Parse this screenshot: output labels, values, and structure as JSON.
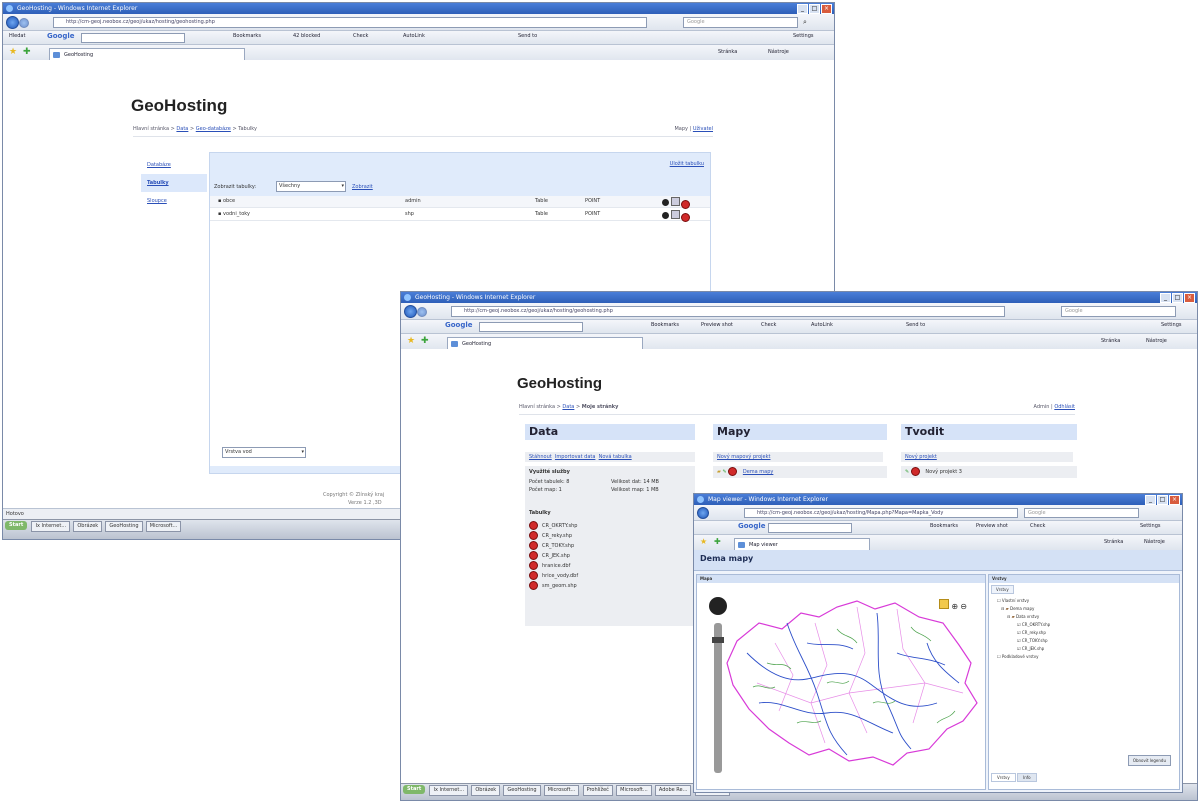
{
  "window1": {
    "title": "GeoHosting - Windows Internet Explorer",
    "address": "http://cm-geoj.neobox.cz/geoj/ukaz/hosting/geohosting.php",
    "search_placeholder": "Google",
    "toolbar": {
      "label": "Hledat",
      "google": "Google",
      "bookmarks": "Bookmarks",
      "blocked": "42 blocked",
      "check": "Check",
      "autolink": "AutoLink",
      "send": "Send to",
      "settings": "Settings"
    },
    "tab": "GeoHosting",
    "cmd": {
      "page": "Stránka",
      "tools": "Nástroje"
    },
    "page": {
      "title": "GeoHosting",
      "breadcrumb": [
        "Hlavní stránka",
        "Data",
        "Geo-databáze",
        "Tabulky"
      ],
      "right_links": [
        "Mapy",
        "Uživatel"
      ],
      "sidebar": [
        "Databáze",
        "Tabulky",
        "Sloupce"
      ],
      "link_top": "Uložit tabulku",
      "filter_label": "Zobrazit tabulky:",
      "filter_value": "Všechny",
      "filter_button": "Zobrazit",
      "rows": [
        {
          "name": "obce",
          "owner": "admin",
          "type": "Table",
          "geom": "POINT"
        },
        {
          "name": "vodni_toky",
          "owner": "shp",
          "type": "Table",
          "geom": "POINT"
        }
      ],
      "footer_select": "Vrstva vod",
      "copyright": "Copyright © Zlínský kraj",
      "version": "Verze 1.2 ,3D"
    },
    "status": "Hotovo"
  },
  "window2": {
    "title": "GeoHosting - Windows Internet Explorer",
    "address": "http://cm-geoj.neobox.cz/geoj/ukaz/hosting/geohosting.php",
    "search_placeholder": "Google",
    "tab": "GeoHosting",
    "toolbar": {
      "preview": "Preview shot"
    },
    "page": {
      "title": "GeoHosting",
      "breadcrumb": [
        "Hlavní stránka",
        "Data",
        "Moje stránky"
      ],
      "right_links": [
        "Admin",
        "Odhlásit"
      ],
      "columns": [
        {
          "header": "Data",
          "links": [
            "Stáhnout",
            "Importovat data",
            "Nová tabulka"
          ]
        },
        {
          "header": "Mapy",
          "links": [
            "Nový mapový projekt"
          ],
          "item": "Dema mapy"
        },
        {
          "header": "Tvodit",
          "links": [
            "Nový projekt"
          ],
          "item": "Nový projekt 3"
        }
      ],
      "stats_title": "Využité služby",
      "stats": [
        "Počet tabulek: 8",
        "Počet map: 1",
        "Velikost dat: 14 MB",
        "Velikost map: 1 MB"
      ],
      "tables_title": "Tabulky",
      "tables": [
        "CR_OKRTY.shp",
        "CR_reky.shp",
        "CR_TOKY.shp",
        "CR_JEK.shp",
        "hranice.dbf",
        "hrice_vody.dbf",
        "sm_geom.shp"
      ]
    }
  },
  "window3": {
    "title": "Map viewer - Windows Internet Explorer",
    "address": "http://cm-geoj.neobox.cz/geoj/ukaz/hosting/Mapa.php?Mapa=Mapka_Vody",
    "search_placeholder": "Google",
    "tab": "Map viewer",
    "page": {
      "title": "Dema mapy",
      "panel_left": "Mapa",
      "panel_right": "Vrstvy",
      "layer_tab": "Vrstvy",
      "layers": [
        "Vlastní vrstvy",
        "Dema mapy",
        "Data vrstvy",
        "CR_OKRTY.shp",
        "CR_reky.shp",
        "CR_TOKY.shp",
        "CR_JEK.shp",
        "Podkladové vrstvy"
      ],
      "bottom_tabs": [
        "Vrstvy",
        "Info"
      ],
      "button": "Obnovit legendu"
    }
  },
  "taskbar": {
    "start": "Start",
    "items": [
      "Ix Internet...",
      "Obrázek",
      "GeoHosting",
      "Microsoft...",
      "Prohlížeč",
      "Microsoft...",
      "Adobe Re...",
      "Microsoft..."
    ]
  },
  "colors": {
    "accent": "#2a4fb8",
    "panel": "#e0ebfb",
    "title": "#2e5fb8",
    "delete": "#d02a2a",
    "map_border": "#d83ad8",
    "rivers": "#2d4fc9",
    "streams": "#4aa14a"
  }
}
